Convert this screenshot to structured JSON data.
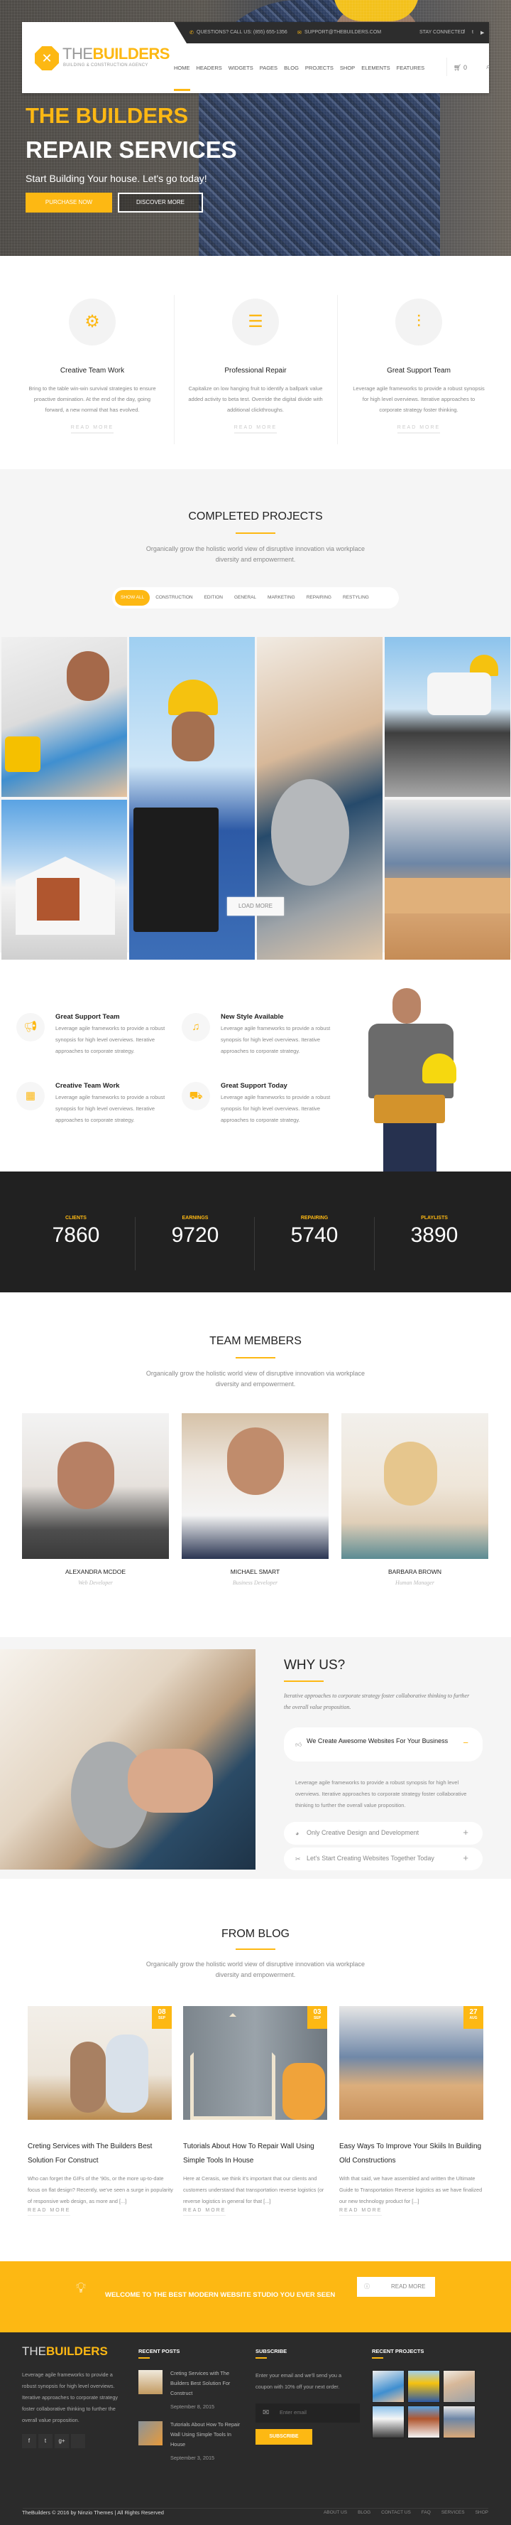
{
  "header": {
    "phone_label": "QUESTIONS? CALL US: (855) 655-1356",
    "email_label": "SUPPORT@THEBUILDERS.COM",
    "stay_connected": "STAY CONNECTED",
    "social_icons": [
      "facebook-icon",
      "twitter-icon",
      "youtube-icon"
    ],
    "logo_the": "THE",
    "logo_builders": "BUILDERS",
    "logo_tagline": "BUILDING & CONSTRUCTION AGENCY",
    "nav": [
      "HOME",
      "HEADERS",
      "WIDGETS",
      "PAGES",
      "BLOG",
      "PROJECTS",
      "SHOP",
      "ELEMENTS",
      "FEATURES"
    ],
    "active_nav": "HOME",
    "cart_count": "0"
  },
  "hero": {
    "title_line1": "THE BUILDERS",
    "title_line2": "REPAIR SERVICES",
    "subtitle": "Start Building Your house. Let's go today!",
    "primary_button": "PURCHASE NOW",
    "secondary_button": "DISCOVER MORE"
  },
  "features": [
    {
      "icon": "gear-icon",
      "title": "Creative Team Work",
      "text": "Bring to the table win-win survival strategies to ensure proactive domination. At the end of the day, going forward, a new normal that has evolved.",
      "link": "READ MORE"
    },
    {
      "icon": "database-icon",
      "title": "Professional Repair",
      "text": "Capitalize on low hanging fruit to identify a ballpark value added activity to beta test. Override the digital divide with additional clickthroughs.",
      "link": "READ MORE"
    },
    {
      "icon": "sliders-icon",
      "title": "Great Support Team",
      "text": "Leverage agile frameworks to provide a robust synopsis for high level overviews. Iterative approaches to corporate strategy foster thinking.",
      "link": "READ MORE"
    }
  ],
  "projects": {
    "title": "COMPLETED PROJECTS",
    "description": "Organically grow the holistic world view of disruptive innovation via workplace diversity and empowerment.",
    "filters": [
      "SHOW ALL",
      "CONSTRUCTION",
      "EDITION",
      "GENERAL",
      "MARKETING",
      "REPAIRING",
      "RESTYLING"
    ],
    "active_filter": "SHOW ALL",
    "load_more": "LOAD MORE"
  },
  "services": [
    {
      "icon": "megaphone-icon",
      "title": "Great Support Team",
      "text": "Leverage agile frameworks to provide a robust synopsis for high level overviews. Iterative approaches to corporate strategy."
    },
    {
      "icon": "music-note-icon",
      "title": "New Style Available",
      "text": "Leverage agile frameworks to provide a robust synopsis for high level overviews. Iterative approaches to corporate strategy."
    },
    {
      "icon": "calendar-icon",
      "title": "Creative Team Work",
      "text": "Leverage agile frameworks to provide a robust synopsis for high level overviews. Iterative approaches to corporate strategy."
    },
    {
      "icon": "truck-icon",
      "title": "Great Support Today",
      "text": "Leverage agile frameworks to provide a robust synopsis for high level overviews. Iterative approaches to corporate strategy."
    }
  ],
  "counters": [
    {
      "label": "CLIENTS",
      "value": "7860"
    },
    {
      "label": "EARNINGS",
      "value": "9720"
    },
    {
      "label": "REPAIRING",
      "value": "5740"
    },
    {
      "label": "PLAYLISTS",
      "value": "3890"
    }
  ],
  "team": {
    "title": "TEAM MEMBERS",
    "description": "Organically grow the holistic world view of disruptive innovation via workplace diversity and empowerment.",
    "members": [
      {
        "name": "ALEXANDRA MCDOE",
        "role": "Web Developer"
      },
      {
        "name": "MICHAEL SMART",
        "role": "Business Developer"
      },
      {
        "name": "BARBARA BROWN",
        "role": "Human Manager"
      }
    ]
  },
  "why": {
    "title": "WHY US?",
    "intro": "Iterative approaches to corporate strategy foster collaborative thinking to further the overall value proposition.",
    "items": [
      {
        "icon": "thumbs-up-icon",
        "title": "We Create Awesome Websites For Your Business",
        "toggle": "−",
        "expanded": true,
        "body": "Leverage agile frameworks to provide a robust synopsis for high level overviews. Iterative approaches to corporate strategy foster collaborative thinking to further the overall value proposition."
      },
      {
        "icon": "pie-chart-icon",
        "title": "Only Creative Design and Development",
        "toggle": "+",
        "expanded": false
      },
      {
        "icon": "tools-icon",
        "title": "Let's Start Creating Websites Together Today",
        "toggle": "+",
        "expanded": false
      }
    ]
  },
  "blog": {
    "title": "FROM BLOG",
    "description": "Organically grow the holistic world view of disruptive innovation via workplace diversity and empowerment.",
    "posts": [
      {
        "day": "08",
        "month": "SEP",
        "title": "Creting Services with The Builders Best Solution For Construct",
        "excerpt": "Who can forget the GIFs of the '90s, or the more up-to-date focus on flat design? Recently, we've seen a surge in popularity of responsive web design, as more and [...]",
        "link": "READ MORE"
      },
      {
        "day": "03",
        "month": "SEP",
        "title": "Tutorials About How To Repair Wall Using Simple Tools In House",
        "excerpt": "Here at Cerasis, we think it's important that our clients and customers understand that transportation reverse logistics (or reverse logistics in general for that [...]",
        "link": "READ MORE"
      },
      {
        "day": "27",
        "month": "AUG",
        "title": "Easy Ways To Improve Your Skiils In Building Old Constructions",
        "excerpt": "With that said, we have assembled and written the Ultimate Guide to Transportation Reverse logistics as we have finalized our new technology product for [...]",
        "link": "READ MORE"
      }
    ]
  },
  "cta": {
    "text": "WELCOME TO THE BEST MODERN WEBSITE STUDIO YOU EVER SEEN",
    "button": "READ MORE"
  },
  "footer": {
    "logo_the": "THE",
    "logo_builders": "BUILDERS",
    "about": "Leverage agile frameworks to provide a robust synopsis for high level overviews. Iterative approaches to corporate strategy foster collaborative thinking to further the overall value proposition.",
    "social": [
      "facebook-icon",
      "twitter-icon",
      "google-plus-icon",
      "apple-icon"
    ],
    "recent_posts_title": "RECENT POSTS",
    "recent_posts": [
      {
        "title": "Creting Services with The Builders Best Solution For Construct",
        "date": "September 8, 2015"
      },
      {
        "title": "Tutorials About How To Repair Wall Using Simple Tools In House",
        "date": "September 3, 2015"
      }
    ],
    "subscribe_title": "SUBSCRIBE",
    "subscribe_text": "Enter your email and we'll send you a coupon with 10% off your next order.",
    "email_placeholder": "Enter email",
    "subscribe_button": "SUBSCRIBE",
    "recent_projects_title": "RECENT PROJECTS",
    "copyright": "TheBuilders © 2016 by Ninzio Themes | All Rights Reserved",
    "links": [
      "ABOUT US",
      "BLOG",
      "CONTACT US",
      "FAQ",
      "SERVICES",
      "SHOP"
    ]
  },
  "colors": {
    "accent": "#fdb813",
    "dark": "#2b2b2b",
    "counter_bg": "#212121",
    "light_bg": "#f5f5f5"
  }
}
